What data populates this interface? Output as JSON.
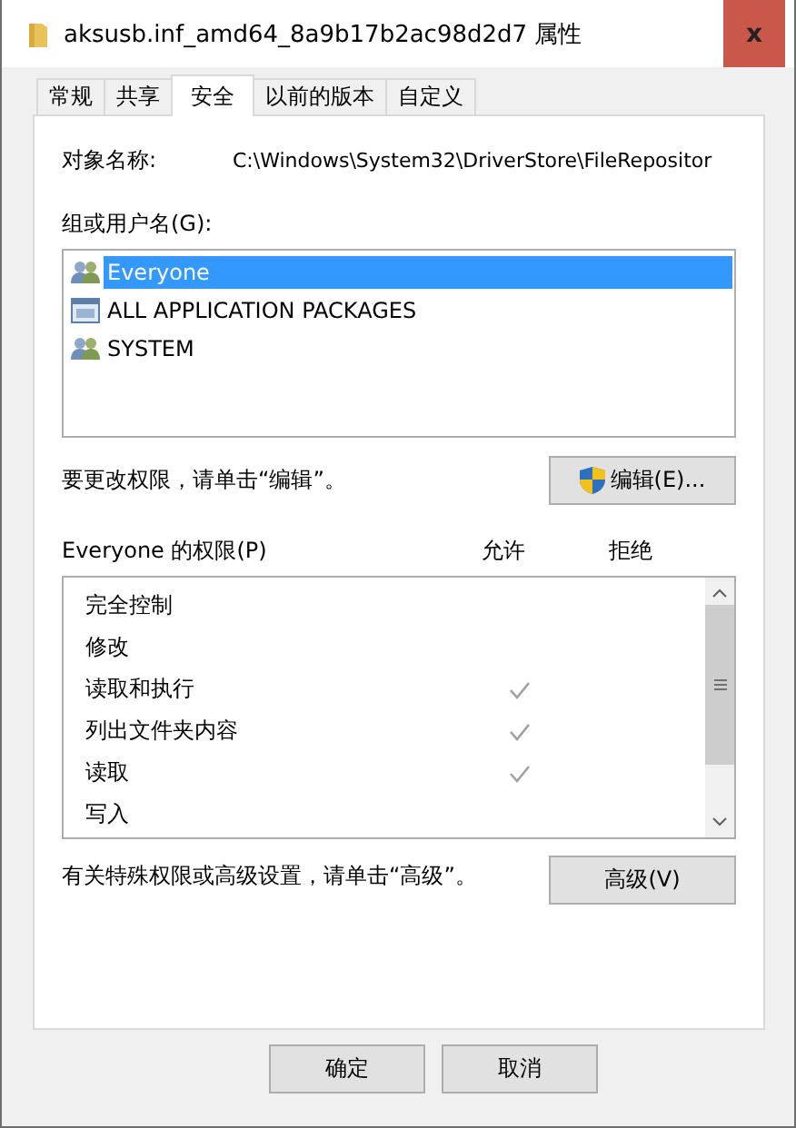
{
  "window": {
    "title": "aksusb.inf_amd64_8a9b17b2ac98d2d7 属性",
    "close": "x"
  },
  "tabs": [
    {
      "label": "常规",
      "selected": false
    },
    {
      "label": "共享",
      "selected": false
    },
    {
      "label": "安全",
      "selected": true
    },
    {
      "label": "以前的版本",
      "selected": false
    },
    {
      "label": "自定义",
      "selected": false
    }
  ],
  "object_name": {
    "label": "对象名称:",
    "value": "C:\\Windows\\System32\\DriverStore\\FileRepositor"
  },
  "groups": {
    "label": "组或用户名(G):",
    "items": [
      {
        "name": "Everyone",
        "kind": "group",
        "selected": true
      },
      {
        "name": "ALL APPLICATION PACKAGES",
        "kind": "package",
        "selected": false
      },
      {
        "name": "SYSTEM",
        "kind": "group",
        "selected": false
      }
    ]
  },
  "edit_hint": "要更改权限，请单击“编辑”。",
  "edit_button": "编辑(E)...",
  "permissions": {
    "label": "Everyone 的权限(P)",
    "allow_header": "允许",
    "deny_header": "拒绝",
    "rows": [
      {
        "name": "完全控制",
        "allow": false,
        "deny": false
      },
      {
        "name": "修改",
        "allow": false,
        "deny": false
      },
      {
        "name": "读取和执行",
        "allow": true,
        "deny": false
      },
      {
        "name": "列出文件夹内容",
        "allow": true,
        "deny": false
      },
      {
        "name": "读取",
        "allow": true,
        "deny": false
      },
      {
        "name": "写入",
        "allow": false,
        "deny": false
      }
    ]
  },
  "advanced_hint": "有关特殊权限或高级设置，请单击“高级”。",
  "advanced_button": "高级(V)",
  "buttons": [
    "确定",
    "取消"
  ]
}
